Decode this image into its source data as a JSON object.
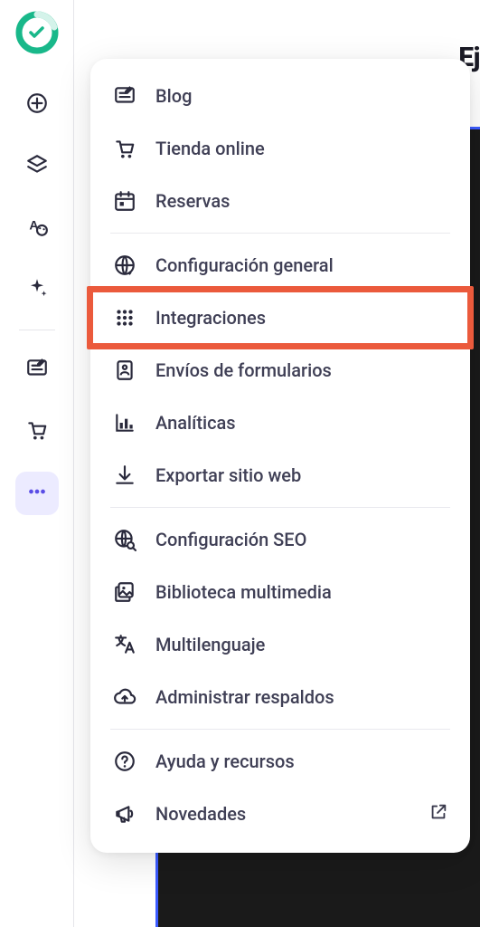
{
  "header": {
    "peek_text": "Ej"
  },
  "rail": {
    "items": [
      {
        "name": "add",
        "icon": "plus-circle-icon"
      },
      {
        "name": "layers",
        "icon": "layers-icon"
      },
      {
        "name": "styles",
        "icon": "text-palette-icon"
      },
      {
        "name": "ai",
        "icon": "sparkles-icon"
      },
      {
        "name": "blog",
        "icon": "blog-icon"
      },
      {
        "name": "store",
        "icon": "cart-icon"
      },
      {
        "name": "more",
        "icon": "dots-icon",
        "active": true
      }
    ]
  },
  "menu": {
    "groups": [
      [
        {
          "icon": "blog-icon",
          "label": "Blog"
        },
        {
          "icon": "cart-icon",
          "label": "Tienda online"
        },
        {
          "icon": "calendar-icon",
          "label": "Reservas"
        }
      ],
      [
        {
          "icon": "globe-gear-icon",
          "label": "Configuración general"
        },
        {
          "icon": "grid-dots-icon",
          "label": "Integraciones",
          "highlighted": true
        },
        {
          "icon": "form-icon",
          "label": "Envíos de formularios"
        },
        {
          "icon": "chart-icon",
          "label": "Analíticas"
        },
        {
          "icon": "download-icon",
          "label": "Exportar sitio web"
        }
      ],
      [
        {
          "icon": "seo-globe-icon",
          "label": "Configuración SEO"
        },
        {
          "icon": "media-icon",
          "label": "Biblioteca multimedia"
        },
        {
          "icon": "translate-icon",
          "label": "Multilenguaje"
        },
        {
          "icon": "cloud-sync-icon",
          "label": "Administrar respaldos"
        }
      ],
      [
        {
          "icon": "help-icon",
          "label": "Ayuda y recursos"
        },
        {
          "icon": "megaphone-icon",
          "label": "Novedades",
          "trailing": "external-link-icon"
        }
      ]
    ]
  }
}
